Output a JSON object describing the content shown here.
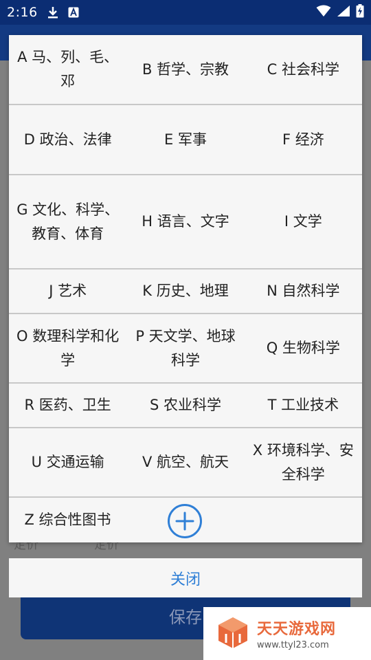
{
  "status_bar": {
    "time": "2:16",
    "icons": [
      "download-icon",
      "text-a-icon",
      "wifi-icon",
      "signal-icon",
      "battery-charging-icon"
    ]
  },
  "background": {
    "field_label": "定价",
    "field_value": "定价",
    "save_button": "保存"
  },
  "dialog": {
    "categories": [
      [
        "A 马、列、毛、邓",
        "B 哲学、宗教",
        "C 社会科学"
      ],
      [
        "D 政治、法律",
        "E 军事",
        "F 经济"
      ],
      [
        "G 文化、科学、教育、体育",
        "H 语言、文字",
        "I 文学"
      ],
      [
        "J 艺术",
        "K 历史、地理",
        "N 自然科学"
      ],
      [
        "O 数理科学和化学",
        "P 天文学、地球科学",
        "Q 生物科学"
      ],
      [
        "R 医药、卫生",
        "S 农业科学",
        "T 工业技术"
      ],
      [
        "U 交通运输",
        "V 航空、航天",
        "X 环境科学、安全科学"
      ]
    ],
    "last": "Z 综合性图书",
    "add_icon": "plus-circle-icon",
    "close_label": "关闭"
  },
  "watermark": {
    "title": "天天游戏网",
    "url": "www.ttyl23.com"
  },
  "colors": {
    "status_bar": "#0b2d73",
    "accent_blue": "#2f7fd6",
    "save_button": "#0f3476",
    "watermark_orange": "#e8693c"
  }
}
